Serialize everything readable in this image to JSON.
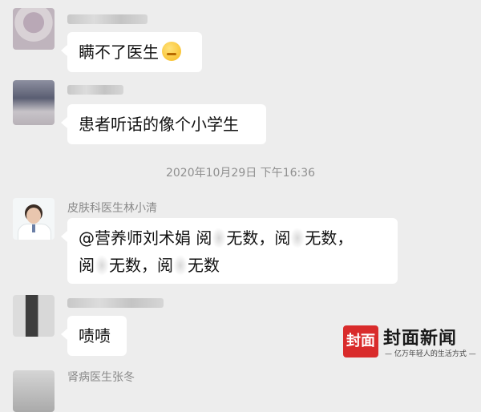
{
  "messages": [
    {
      "nickname": "",
      "text": "瞒不了医生",
      "emoji": "thinking-face-emoji"
    },
    {
      "nickname": "",
      "text": "患者听话的像个小学生"
    }
  ],
  "timestamp": "2020年10月29日 下午16:36",
  "messages2": [
    {
      "nickname": "皮肤科医生林小清",
      "line1_a": "@营养师刘术娟  阅",
      "line1_b": "无数，阅",
      "line1_c": "无数，",
      "line2_a": "阅",
      "line2_b": "无数，阅",
      "line2_c": "无数"
    },
    {
      "nickname": "",
      "text": "啧啧"
    },
    {
      "nickname": "肾病医生张冬"
    }
  ],
  "watermark": {
    "logo": "封面",
    "title": "封面新闻",
    "subtitle": "— 亿万年轻人的生活方式 —"
  }
}
